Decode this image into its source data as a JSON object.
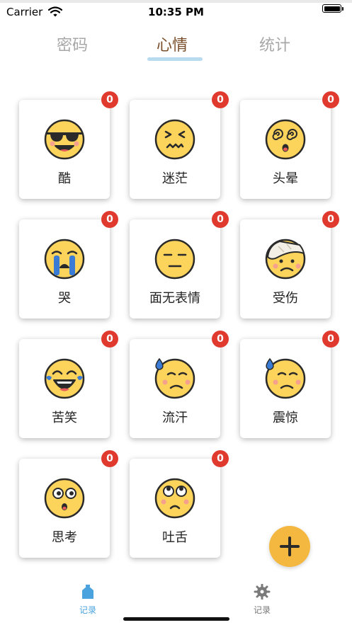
{
  "status_bar": {
    "carrier": "Carrier",
    "time": "10:35 PM"
  },
  "tabs": [
    {
      "label": "密码",
      "active": false
    },
    {
      "label": "心情",
      "active": true
    },
    {
      "label": "统计",
      "active": false
    }
  ],
  "moods": [
    {
      "label": "酷",
      "count": "0",
      "icon": "cool-sunglasses-face-icon"
    },
    {
      "label": "迷茫",
      "count": "0",
      "icon": "confused-squint-face-icon"
    },
    {
      "label": "头晕",
      "count": "0",
      "icon": "dizzy-face-icon"
    },
    {
      "label": "哭",
      "count": "0",
      "icon": "crying-face-icon"
    },
    {
      "label": "面无表情",
      "count": "0",
      "icon": "expressionless-face-icon"
    },
    {
      "label": "受伤",
      "count": "0",
      "icon": "injured-bandage-face-icon"
    },
    {
      "label": "苦笑",
      "count": "0",
      "icon": "tears-of-joy-face-icon"
    },
    {
      "label": "流汗",
      "count": "0",
      "icon": "sweat-face-icon"
    },
    {
      "label": "震惊",
      "count": "0",
      "icon": "shocked-sweat-face-icon"
    },
    {
      "label": "思考",
      "count": "0",
      "icon": "thinking-face-icon"
    },
    {
      "label": "吐舌",
      "count": "0",
      "icon": "eye-roll-face-icon"
    }
  ],
  "fab": {
    "icon": "plus-icon"
  },
  "bottom_nav": [
    {
      "label": "记录",
      "icon": "home-icon",
      "active": true
    },
    {
      "label": "记录",
      "icon": "gear-icon",
      "active": false
    }
  ],
  "colors": {
    "accent": "#f4b73f",
    "badge": "#e03a2f",
    "tab_active": "#7a4e2a",
    "tab_inactive": "#a7a7a7",
    "tab_underline": "#b9dbf0",
    "nav_active": "#4aa3df",
    "face_yellow": "#fcd35b"
  }
}
